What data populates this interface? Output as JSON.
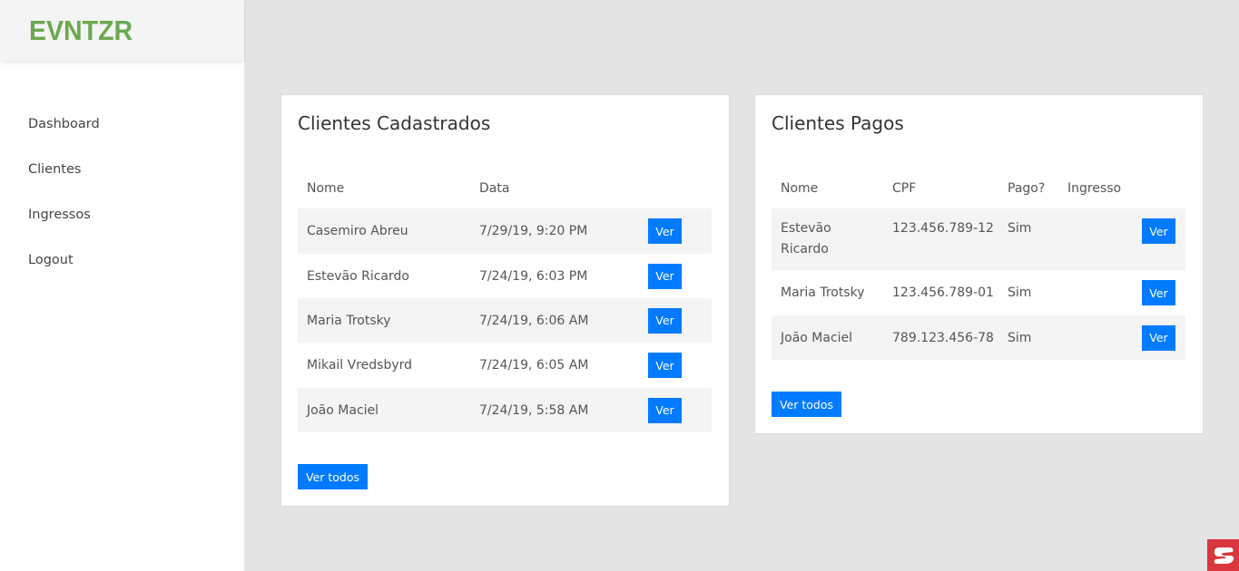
{
  "app": {
    "brand": "EVNTZR"
  },
  "sidebar": {
    "items": [
      {
        "label": "Dashboard"
      },
      {
        "label": "Clientes"
      },
      {
        "label": "Ingressos"
      },
      {
        "label": "Logout"
      }
    ]
  },
  "cadastrados": {
    "title": "Clientes Cadastrados",
    "headers": {
      "nome": "Nome",
      "data": "Data"
    },
    "rows": [
      {
        "nome": "Casemiro Abreu",
        "data": "7/29/19, 9:20 PM",
        "action": "Ver"
      },
      {
        "nome": "Estevão Ricardo",
        "data": "7/24/19, 6:03 PM",
        "action": "Ver"
      },
      {
        "nome": "Maria Trotsky",
        "data": "7/24/19, 6:06 AM",
        "action": "Ver"
      },
      {
        "nome": "Mikail Vredsbyrd",
        "data": "7/24/19, 6:05 AM",
        "action": "Ver"
      },
      {
        "nome": "João Maciel",
        "data": "7/24/19, 5:58 AM",
        "action": "Ver"
      }
    ],
    "view_all": "Ver todos"
  },
  "pagos": {
    "title": "Clientes Pagos",
    "headers": {
      "nome": "Nome",
      "cpf": "CPF",
      "pago": "Pago?",
      "ingresso": "Ingresso"
    },
    "rows": [
      {
        "nome": "Estevão Ricardo",
        "cpf": "123.456.789-12",
        "pago": "Sim",
        "ingresso": "",
        "action": "Ver"
      },
      {
        "nome": "Maria Trotsky",
        "cpf": "123.456.789-01",
        "pago": "Sim",
        "ingresso": "",
        "action": "Ver"
      },
      {
        "nome": "João Maciel",
        "cpf": "789.123.456-78",
        "pago": "Sim",
        "ingresso": "",
        "action": "Ver"
      }
    ],
    "view_all": "Ver todos"
  },
  "colors": {
    "brand": "#6aa84f",
    "primary": "#007bff",
    "widget": "#d9363e"
  },
  "icons": {
    "corner_widget": "chat-widget-icon"
  }
}
